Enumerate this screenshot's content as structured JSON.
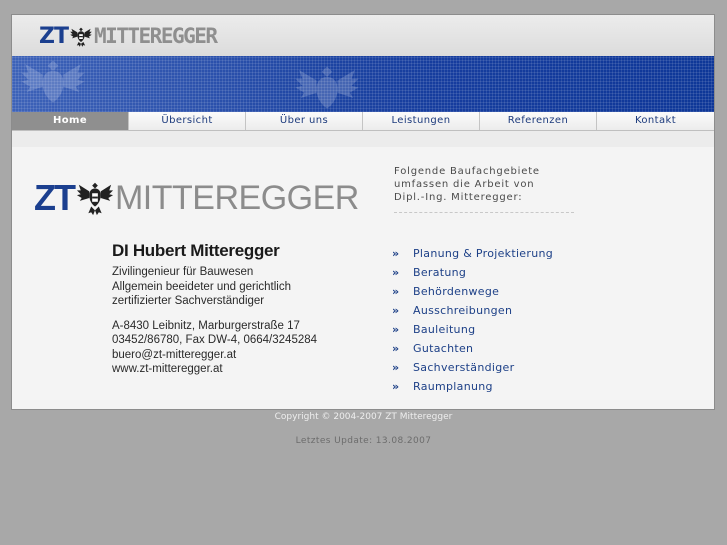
{
  "header": {
    "logo_prefix": "ZT",
    "logo_name": "MITTEREGGER"
  },
  "nav": {
    "items": [
      {
        "label": "Home"
      },
      {
        "label": "Übersicht"
      },
      {
        "label": "Über uns"
      },
      {
        "label": "Leistungen"
      },
      {
        "label": "Referenzen"
      },
      {
        "label": "Kontakt"
      }
    ],
    "active": "Home"
  },
  "card": {
    "logo_prefix": "ZT",
    "logo_name": "MITTEREGGER",
    "person": "DI Hubert Mitteregger",
    "title_lines": [
      "Zivilingenieur für Bauwesen",
      "Allgemein beeideter und gerichtlich",
      "zertifizierter Sachverständiger"
    ],
    "contact_lines": [
      "A-8430 Leibnitz, Marburgerstraße 17",
      "03452/86780, Fax DW-4, 0664/3245284",
      "buero@zt-mitteregger.at",
      "www.zt-mitteregger.at"
    ]
  },
  "intro": {
    "lines": [
      "Folgende Baufachgebiete",
      "umfassen die Arbeit von",
      "Dipl.-Ing. Mitteregger:"
    ]
  },
  "services": {
    "bullet": "»",
    "items": [
      "Planung & Projektierung",
      "Beratung",
      "Behördenwege",
      "Ausschreibungen",
      "Bauleitung",
      "Gutachten",
      "Sachverständiger",
      "Raumplanung"
    ]
  },
  "footer": {
    "copyright": "Copyright © 2004-2007 ZT Mitteregger",
    "update": "Letztes Update: 13.08.2007"
  },
  "colors": {
    "brand_blue": "#1b3f8f",
    "banner_blue": "#1d44a2",
    "link_blue": "#1d4087",
    "nav_active_bg": "#8f8f8f",
    "page_bg": "#a8a8a8"
  }
}
